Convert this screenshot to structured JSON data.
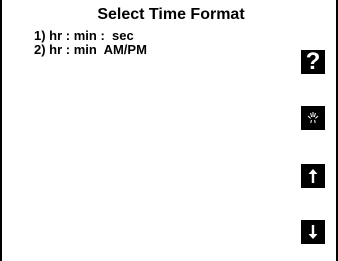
{
  "screen": {
    "title": "Select Time Format",
    "options": [
      {
        "label": "1) hr : min :  sec"
      },
      {
        "label": "2) hr : min  AM/PM"
      }
    ]
  },
  "side_buttons": [
    {
      "icon": "help-icon",
      "glyph": "?"
    },
    {
      "icon": "contrast-icon"
    },
    {
      "icon": "arrow-up-icon"
    },
    {
      "icon": "arrow-down-icon"
    }
  ],
  "colors": {
    "background": "#ffffff",
    "foreground": "#000000"
  }
}
